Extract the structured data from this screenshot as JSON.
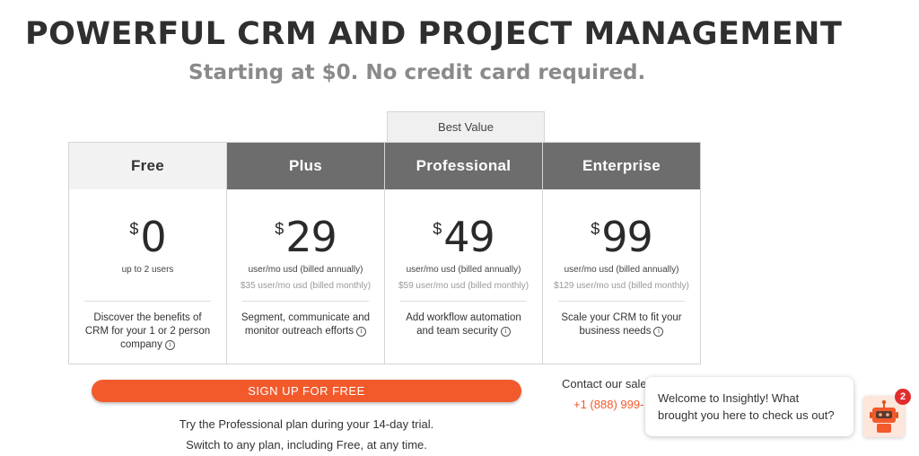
{
  "header": {
    "title": "POWERFUL CRM AND PROJECT MANAGEMENT",
    "subtitle": "Starting at $0. No credit card required."
  },
  "best_value_label": "Best Value",
  "plans": [
    {
      "name": "Free",
      "currency": "$",
      "price": "0",
      "line1": "up to 2 users",
      "line2": "",
      "description": "Discover the benefits of CRM for your 1 or 2 person company"
    },
    {
      "name": "Plus",
      "currency": "$",
      "price": "29",
      "line1": "user/mo usd (billed annually)",
      "line2": "$35 user/mo usd (billed monthly)",
      "description": "Segment, communicate and monitor outreach efforts"
    },
    {
      "name": "Professional",
      "currency": "$",
      "price": "49",
      "line1": "user/mo usd (billed annually)",
      "line2": "$59 user/mo usd (billed monthly)",
      "description": "Add workflow automation and team security"
    },
    {
      "name": "Enterprise",
      "currency": "$",
      "price": "99",
      "line1": "user/mo usd (billed annually)",
      "line2": "$129 user/mo usd (billed monthly)",
      "description": "Scale your CRM to fit your business needs"
    }
  ],
  "info_icon_glyph": "i",
  "signup_label": "SIGN UP FOR FREE",
  "trial_text": [
    "Try the Professional plan during your 14-day trial.",
    "Switch to any plan, including Free, at any time."
  ],
  "contact": {
    "label": "Contact our sale",
    "phone": "+1 (888) 999-"
  },
  "chat": {
    "message": "Welcome to Insightly! What brought you here to check us out?",
    "badge_count": "2",
    "bot_icon": "robot-icon"
  },
  "colors": {
    "accent": "#f25a2c",
    "dark_header": "#6d6d6d",
    "light_header": "#f2f2f2",
    "badge": "#e02d2d"
  }
}
